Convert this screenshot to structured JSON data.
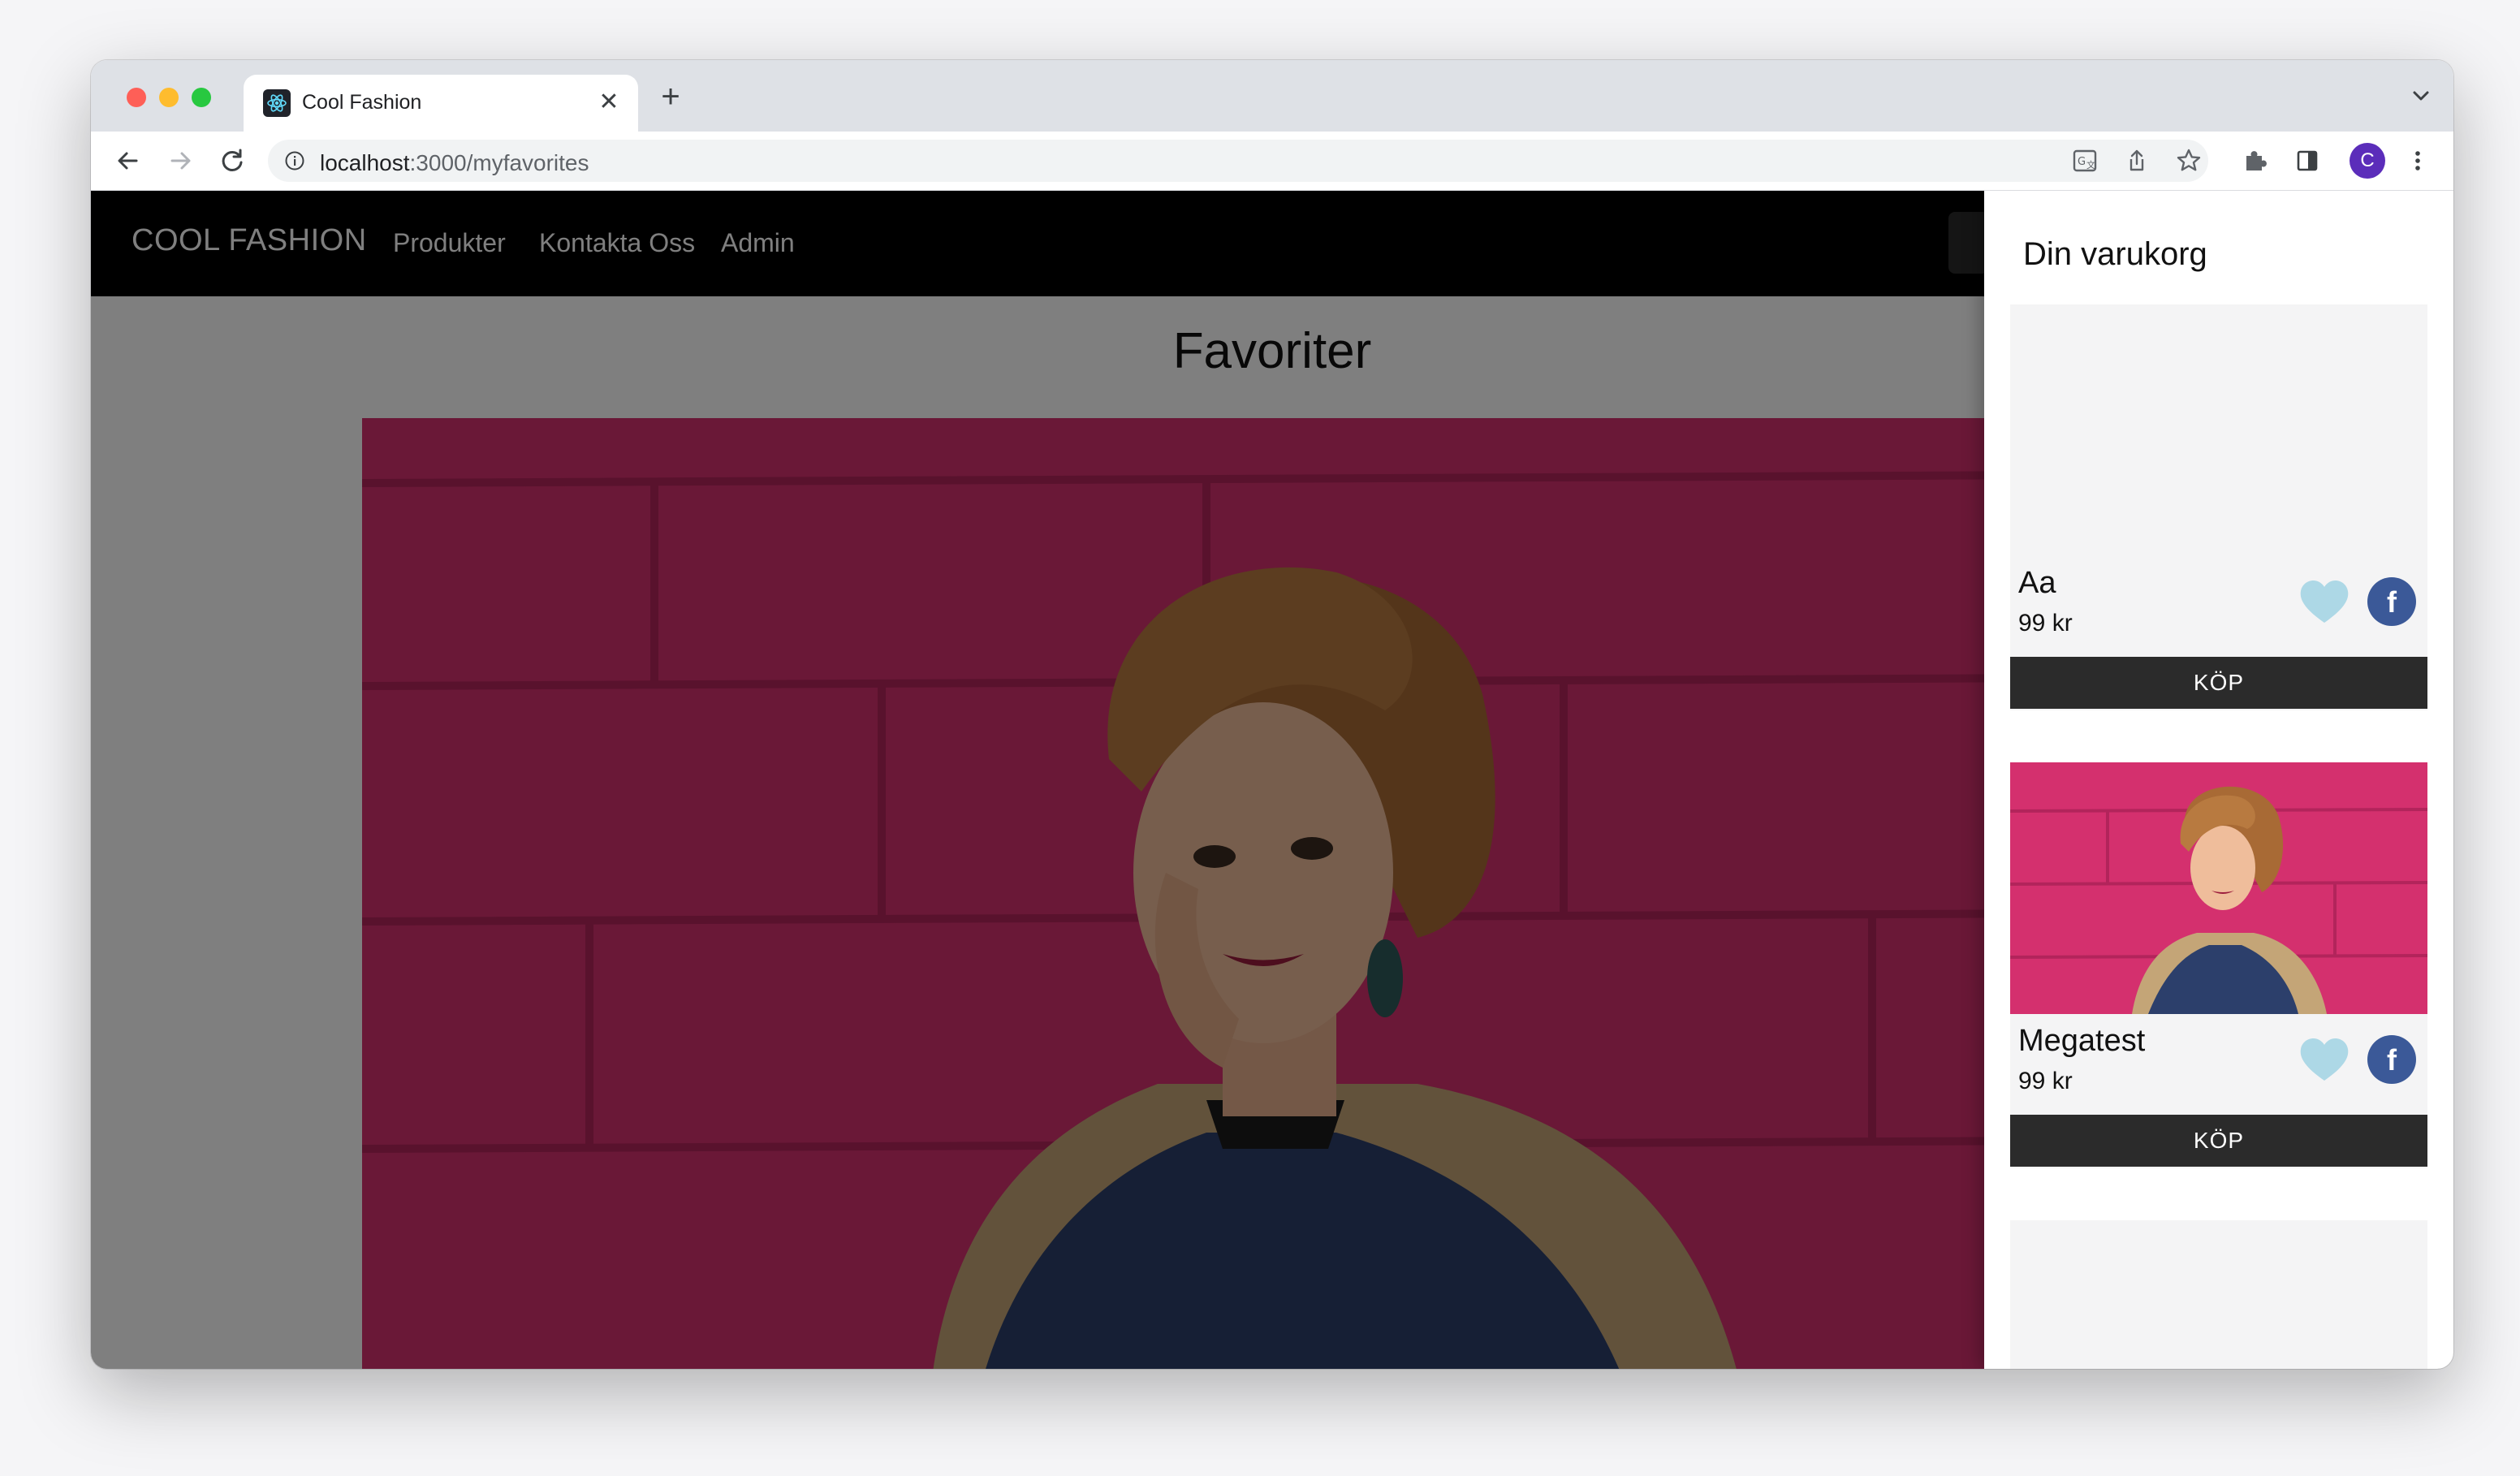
{
  "browser": {
    "tab_title": "Cool Fashion",
    "tab_close": "✕",
    "new_tab": "+",
    "url_host": "localhost",
    "url_path": ":3000/myfavorites",
    "profile_initial": "C",
    "colors": {
      "profile": "#5b2dba",
      "tabstrip": "#dee1e6"
    }
  },
  "app": {
    "brand": "COOL FASHION",
    "nav": [
      {
        "label": "Produkter"
      },
      {
        "label": "Kontakta Oss"
      },
      {
        "label": "Admin"
      }
    ],
    "page_title": "Favoriter",
    "colors": {
      "appbar": "#000000",
      "overlay": "rgba(0,0,0,0.5)"
    }
  },
  "drawer": {
    "title": "Din varukorg",
    "items": [
      {
        "name": "Aa",
        "price": "99 kr",
        "buy_label": "KÖP",
        "has_image": false,
        "favorite": true
      },
      {
        "name": "Megatest",
        "price": "99 kr",
        "buy_label": "KÖP",
        "has_image": true,
        "favorite": true
      }
    ],
    "colors": {
      "heart": "#add8e6",
      "facebook": "#3b5998",
      "buy_button": "#2b2b2b"
    }
  }
}
